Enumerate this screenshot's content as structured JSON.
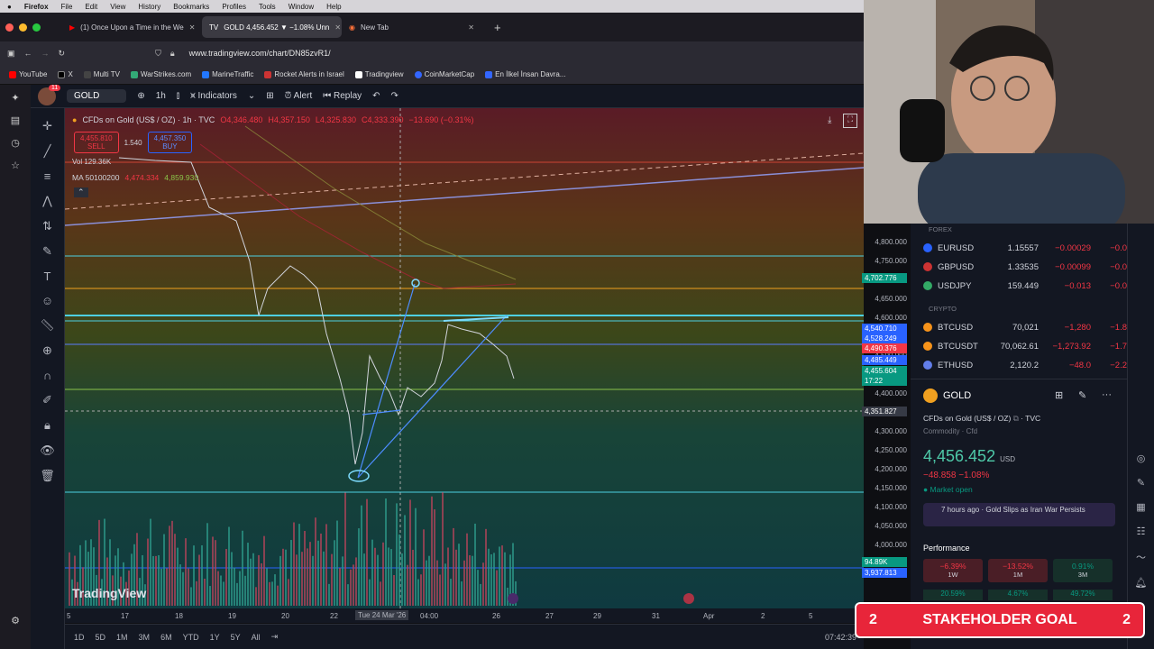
{
  "mac_menu": {
    "app": "Firefox",
    "items": [
      "File",
      "Edit",
      "View",
      "History",
      "Bookmarks",
      "Profiles",
      "Tools",
      "Window",
      "Help"
    ]
  },
  "tabs": [
    {
      "label": "(1) Once Upon a Time in the We"
    },
    {
      "label": "GOLD 4,456.452 ▼ −1.08% Unn"
    },
    {
      "label": "New Tab"
    }
  ],
  "url": "www.tradingview.com/chart/DN85zvR1/",
  "bookmarks": [
    "YouTube",
    "X",
    "Multi TV",
    "WarStrikes.com",
    "MarineTraffic",
    "Rocket Alerts in Israel",
    "Tradingview",
    "CoinMarketCap",
    "En İlkel İnsan Davra..."
  ],
  "toolbar": {
    "symbol": "GOLD",
    "interval": "1h",
    "indicators": "Indicators",
    "alert": "Alert",
    "replay": "Replay",
    "badge": "11"
  },
  "chart_header": {
    "title": "CFDs on Gold (US$ / OZ) · 1h · TVC",
    "o": "O4,346.480",
    "h": "H4,357.150",
    "l": "L4,325.830",
    "c": "C4,333.390",
    "chg": "−13.690 (−0.31%)",
    "sell_price": "4,455.810",
    "sell_label": "SELL",
    "spread": "1.540",
    "buy_price": "4,457.350",
    "buy_label": "BUY",
    "vol": "Vol 129.36K",
    "ma": "MA 50100200",
    "ma_vals": "4,474.334",
    "ma_val2": "4,859.930"
  },
  "price_axis": [
    "4,800.000",
    "4,750.000",
    "4,700.000",
    "4,650.000",
    "4,600.000",
    "4,550.000",
    "4,500.000",
    "4,450.000",
    "4,400.000",
    "4,350.000",
    "4,300.000",
    "4,250.000",
    "4,200.000",
    "4,150.000",
    "4,100.000",
    "4,050.000",
    "4,000.000",
    "3,950.000"
  ],
  "price_tags": [
    {
      "v": "4,702.776",
      "c": "#089981"
    },
    {
      "v": "4,540.710",
      "c": "#2962ff"
    },
    {
      "v": "4,528.249",
      "c": "#2962ff"
    },
    {
      "v": "4,490.376",
      "c": "#f23645"
    },
    {
      "v": "4,485.449",
      "c": "#2962ff"
    },
    {
      "v": "4,455.604",
      "c": "#089981"
    },
    {
      "v": "17:22",
      "c": "#089981"
    },
    {
      "v": "4,351.827",
      "c": "#363a45"
    },
    {
      "v": "94.89K",
      "c": "#089981"
    },
    {
      "v": "3,937.813",
      "c": "#2962ff"
    }
  ],
  "time_axis": [
    "5",
    "17",
    "18",
    "19",
    "20",
    "22",
    "Tue 24 Mar '26",
    "04:00",
    "26",
    "27",
    "29",
    "31",
    "Apr",
    "2",
    "5"
  ],
  "bottom": {
    "ranges": [
      "1D",
      "5D",
      "1M",
      "3M",
      "6M",
      "YTD",
      "1Y",
      "5Y",
      "All"
    ],
    "clock": "07:42:39",
    "brand": "TradingView"
  },
  "watchlist": {
    "forex_header": "FOREX",
    "crypto_header": "CRYPTO",
    "forex": [
      {
        "sym": "EURUSD",
        "last": "1.15557",
        "chg": "−0.00029",
        "pct": "−0.0"
      },
      {
        "sym": "GBPUSD",
        "last": "1.33535",
        "chg": "−0.00099",
        "pct": "−0.0"
      },
      {
        "sym": "USDJPY",
        "last": "159.449",
        "chg": "−0.013",
        "pct": "−0.0"
      }
    ],
    "crypto": [
      {
        "sym": "BTCUSD",
        "last": "70,021",
        "chg": "−1,280",
        "pct": "−1.8"
      },
      {
        "sym": "BTCUSDT",
        "last": "70,062.61",
        "chg": "−1,273.92",
        "pct": "−1.7"
      },
      {
        "sym": "ETHUSD",
        "last": "2,120.2",
        "chg": "−48.0",
        "pct": "−2.2"
      }
    ]
  },
  "details": {
    "symbol": "GOLD",
    "desc": "CFDs on Gold (US$ / OZ)",
    "exch": "TVC",
    "type": "Commodity · Cfd",
    "price": "4,456.452",
    "ccy": "USD",
    "change": "−48.858 −1.08%",
    "status": "Market open",
    "news": "7 hours ago · Gold Slips as Iran War Persists",
    "perf_title": "Performance",
    "perf": [
      {
        "v": "−6.39%",
        "l": "1W"
      },
      {
        "v": "−13.52%",
        "l": "1M"
      },
      {
        "v": "0.91%",
        "l": "3M"
      }
    ],
    "perf2": [
      "20.59%",
      "4.67%",
      "49.72%"
    ]
  },
  "overlay": {
    "text": "STAKEHOLDER GOAL",
    "num": "2"
  }
}
